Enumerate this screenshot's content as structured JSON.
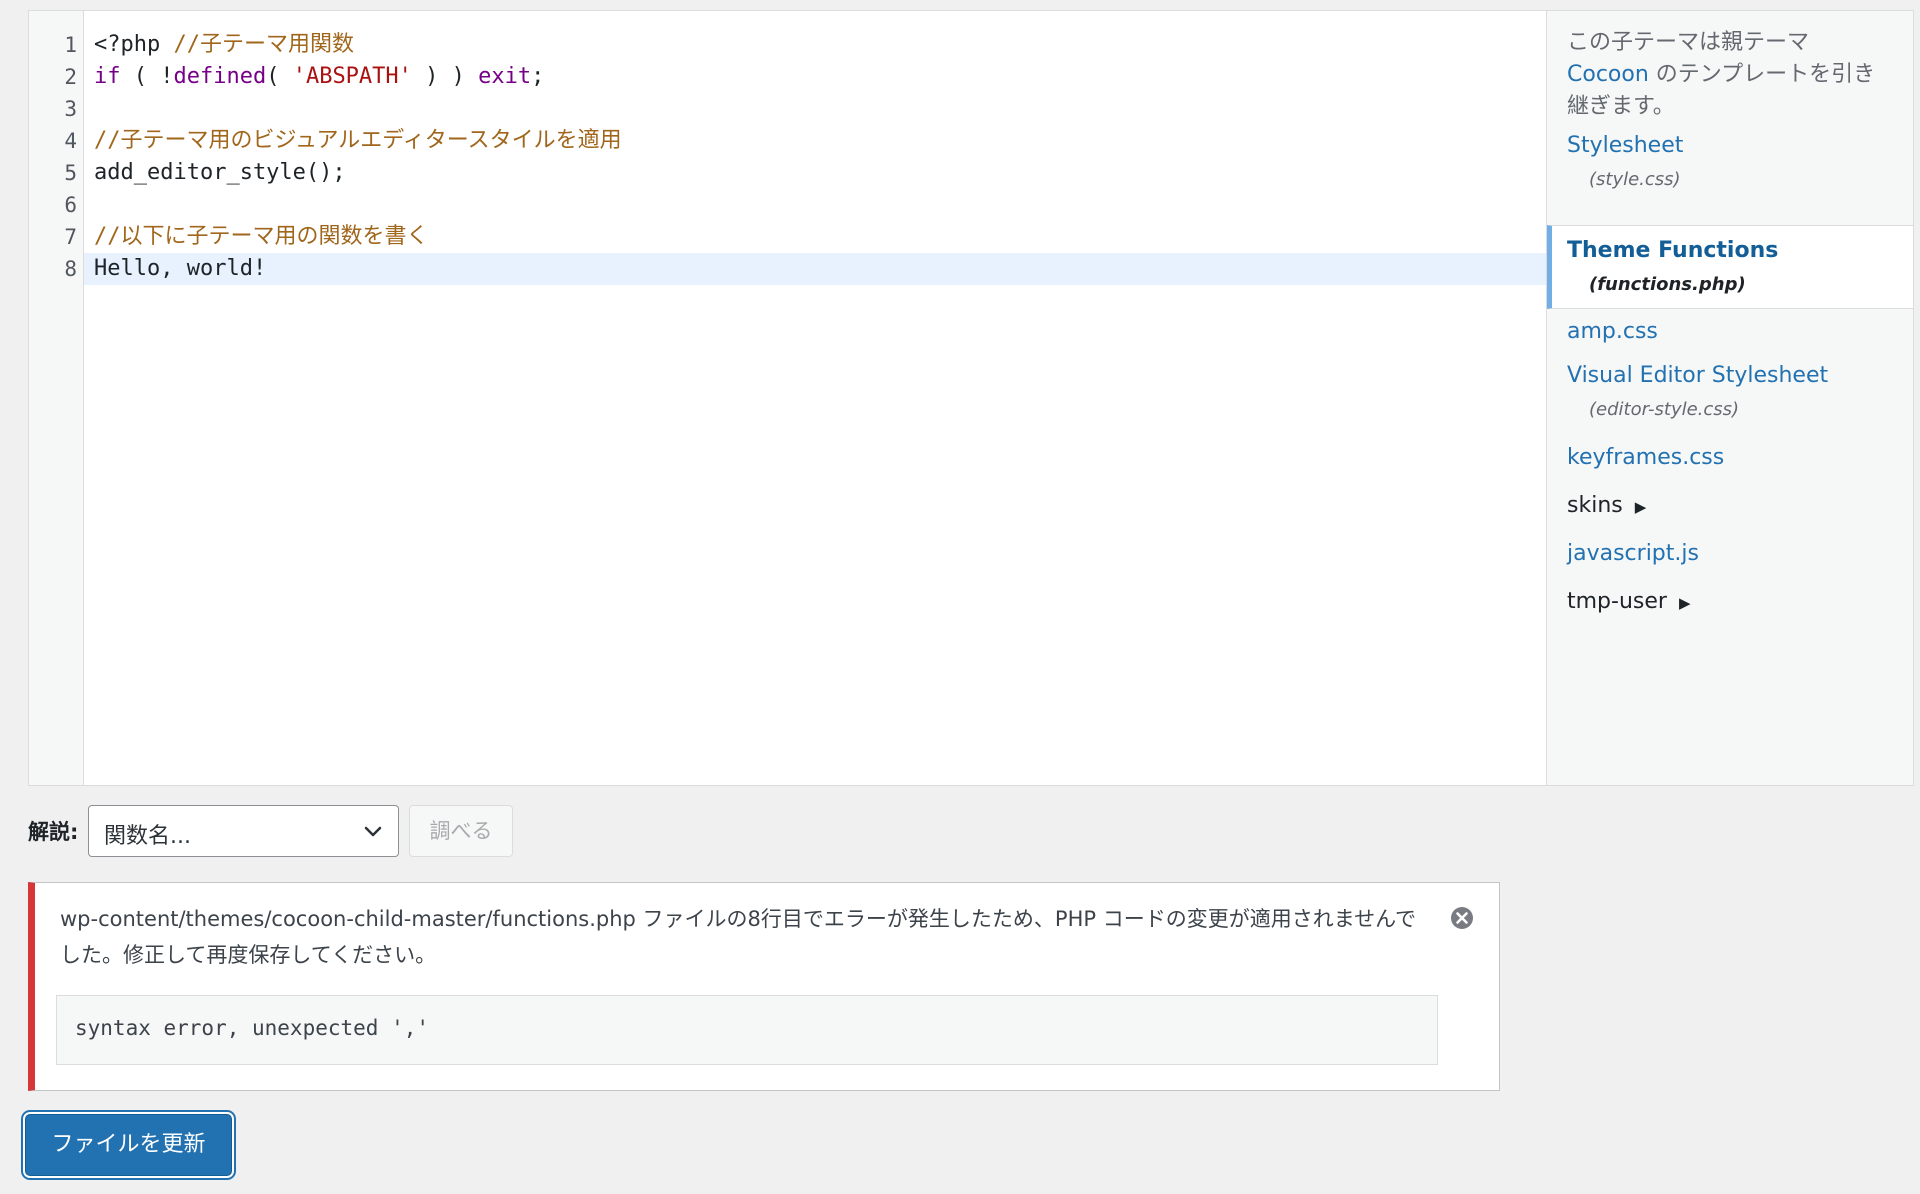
{
  "code_lines": [
    {
      "n": "1",
      "tokens": [
        {
          "t": "<?php ",
          "c": "default"
        },
        {
          "t": "//子テーマ用関数",
          "c": "comment"
        }
      ]
    },
    {
      "n": "2",
      "tokens": [
        {
          "t": "if",
          "c": "keyword"
        },
        {
          "t": " ( !",
          "c": "default"
        },
        {
          "t": "defined",
          "c": "keyword"
        },
        {
          "t": "( ",
          "c": "default"
        },
        {
          "t": "'ABSPATH'",
          "c": "string"
        },
        {
          "t": " ) ) ",
          "c": "default"
        },
        {
          "t": "exit",
          "c": "keyword"
        },
        {
          "t": ";",
          "c": "default"
        }
      ]
    },
    {
      "n": "3",
      "tokens": []
    },
    {
      "n": "4",
      "tokens": [
        {
          "t": "//子テーマ用のビジュアルエディタースタイルを適用",
          "c": "comment"
        }
      ]
    },
    {
      "n": "5",
      "tokens": [
        {
          "t": "add_editor_style();",
          "c": "default"
        }
      ]
    },
    {
      "n": "6",
      "tokens": []
    },
    {
      "n": "7",
      "tokens": [
        {
          "t": "//以下に子テーマ用の関数を書く",
          "c": "comment"
        }
      ]
    },
    {
      "n": "8",
      "tokens": [
        {
          "t": "Hello, world!",
          "c": "default"
        }
      ]
    }
  ],
  "active_line": 8,
  "sidebar": {
    "inherit_pre": "この子テーマは親テーマ ",
    "inherit_link": "Cocoon",
    "inherit_post": " のテンプレートを引き継ぎます。",
    "files": [
      {
        "name": "Stylesheet",
        "sub": "(style.css)"
      },
      {
        "name": "Theme Functions",
        "sub": "(functions.php)",
        "current": true
      },
      {
        "name": "amp.css"
      },
      {
        "name": "Visual Editor Stylesheet",
        "sub": "(editor-style.css)"
      },
      {
        "name": "keyframes.css"
      },
      {
        "name": "skins",
        "folder": true
      },
      {
        "name": "javascript.js"
      },
      {
        "name": "tmp-user",
        "folder": true
      }
    ]
  },
  "documentation": {
    "label": "解説:",
    "select_value": "関数名...",
    "lookup_label": "調べる"
  },
  "notice": {
    "message": "wp-content/themes/cocoon-child-master/functions.php ファイルの8行目でエラーが発生したため、PHP コードの変更が適用されませんでした。修正して再度保存してください。",
    "error_detail": "syntax error, unexpected ','"
  },
  "update_button": "ファイルを更新",
  "colors": {
    "accent": "#2271b1",
    "error": "#d63638",
    "active_line": "#e8f2fe"
  }
}
